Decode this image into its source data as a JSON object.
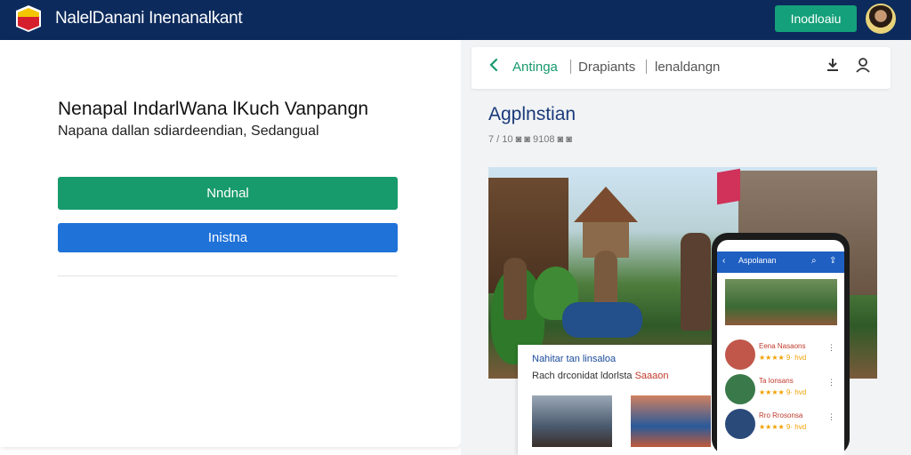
{
  "header": {
    "brand": "NalelDanani Inenanalkant",
    "action_button": "Inodloaiu"
  },
  "hero": {
    "title": "Nenapal IndarlWana lKuch Vanpangn",
    "subtitle": "Napana dallan sdiardeendian, Sedangual",
    "primary_button": "Nndnal",
    "secondary_button": "Inistna"
  },
  "nav": {
    "tabs": [
      {
        "label": "Antinga",
        "color": "#179a6c"
      },
      {
        "label": "Drapiants",
        "color": "#555555"
      },
      {
        "label": "lenaldangn",
        "color": "#555555"
      }
    ]
  },
  "app": {
    "title": "Agplnstian",
    "meta": "7 / 10  ◙  ◙     9108  ◙  ◙"
  },
  "sub_card": {
    "title": "Nahitar tan linsaloa",
    "line_prefix": "Rach drconidat ldorlsta ",
    "line_highlight": "Saaaon"
  },
  "phone": {
    "header": "Aspolanan",
    "items": [
      {
        "name": "Eena Nasaons",
        "stars": "★★★★ 9· hvd"
      },
      {
        "name": "Ta Ionsans",
        "stars": "★★★★ 9· hvd"
      },
      {
        "name": "Rro Rrosonsa",
        "stars": "★★★★ 9· hvd"
      }
    ]
  },
  "colors": {
    "topbar": "#0c2a5c",
    "accent_green": "#179a6c",
    "accent_blue": "#1f72d8"
  }
}
